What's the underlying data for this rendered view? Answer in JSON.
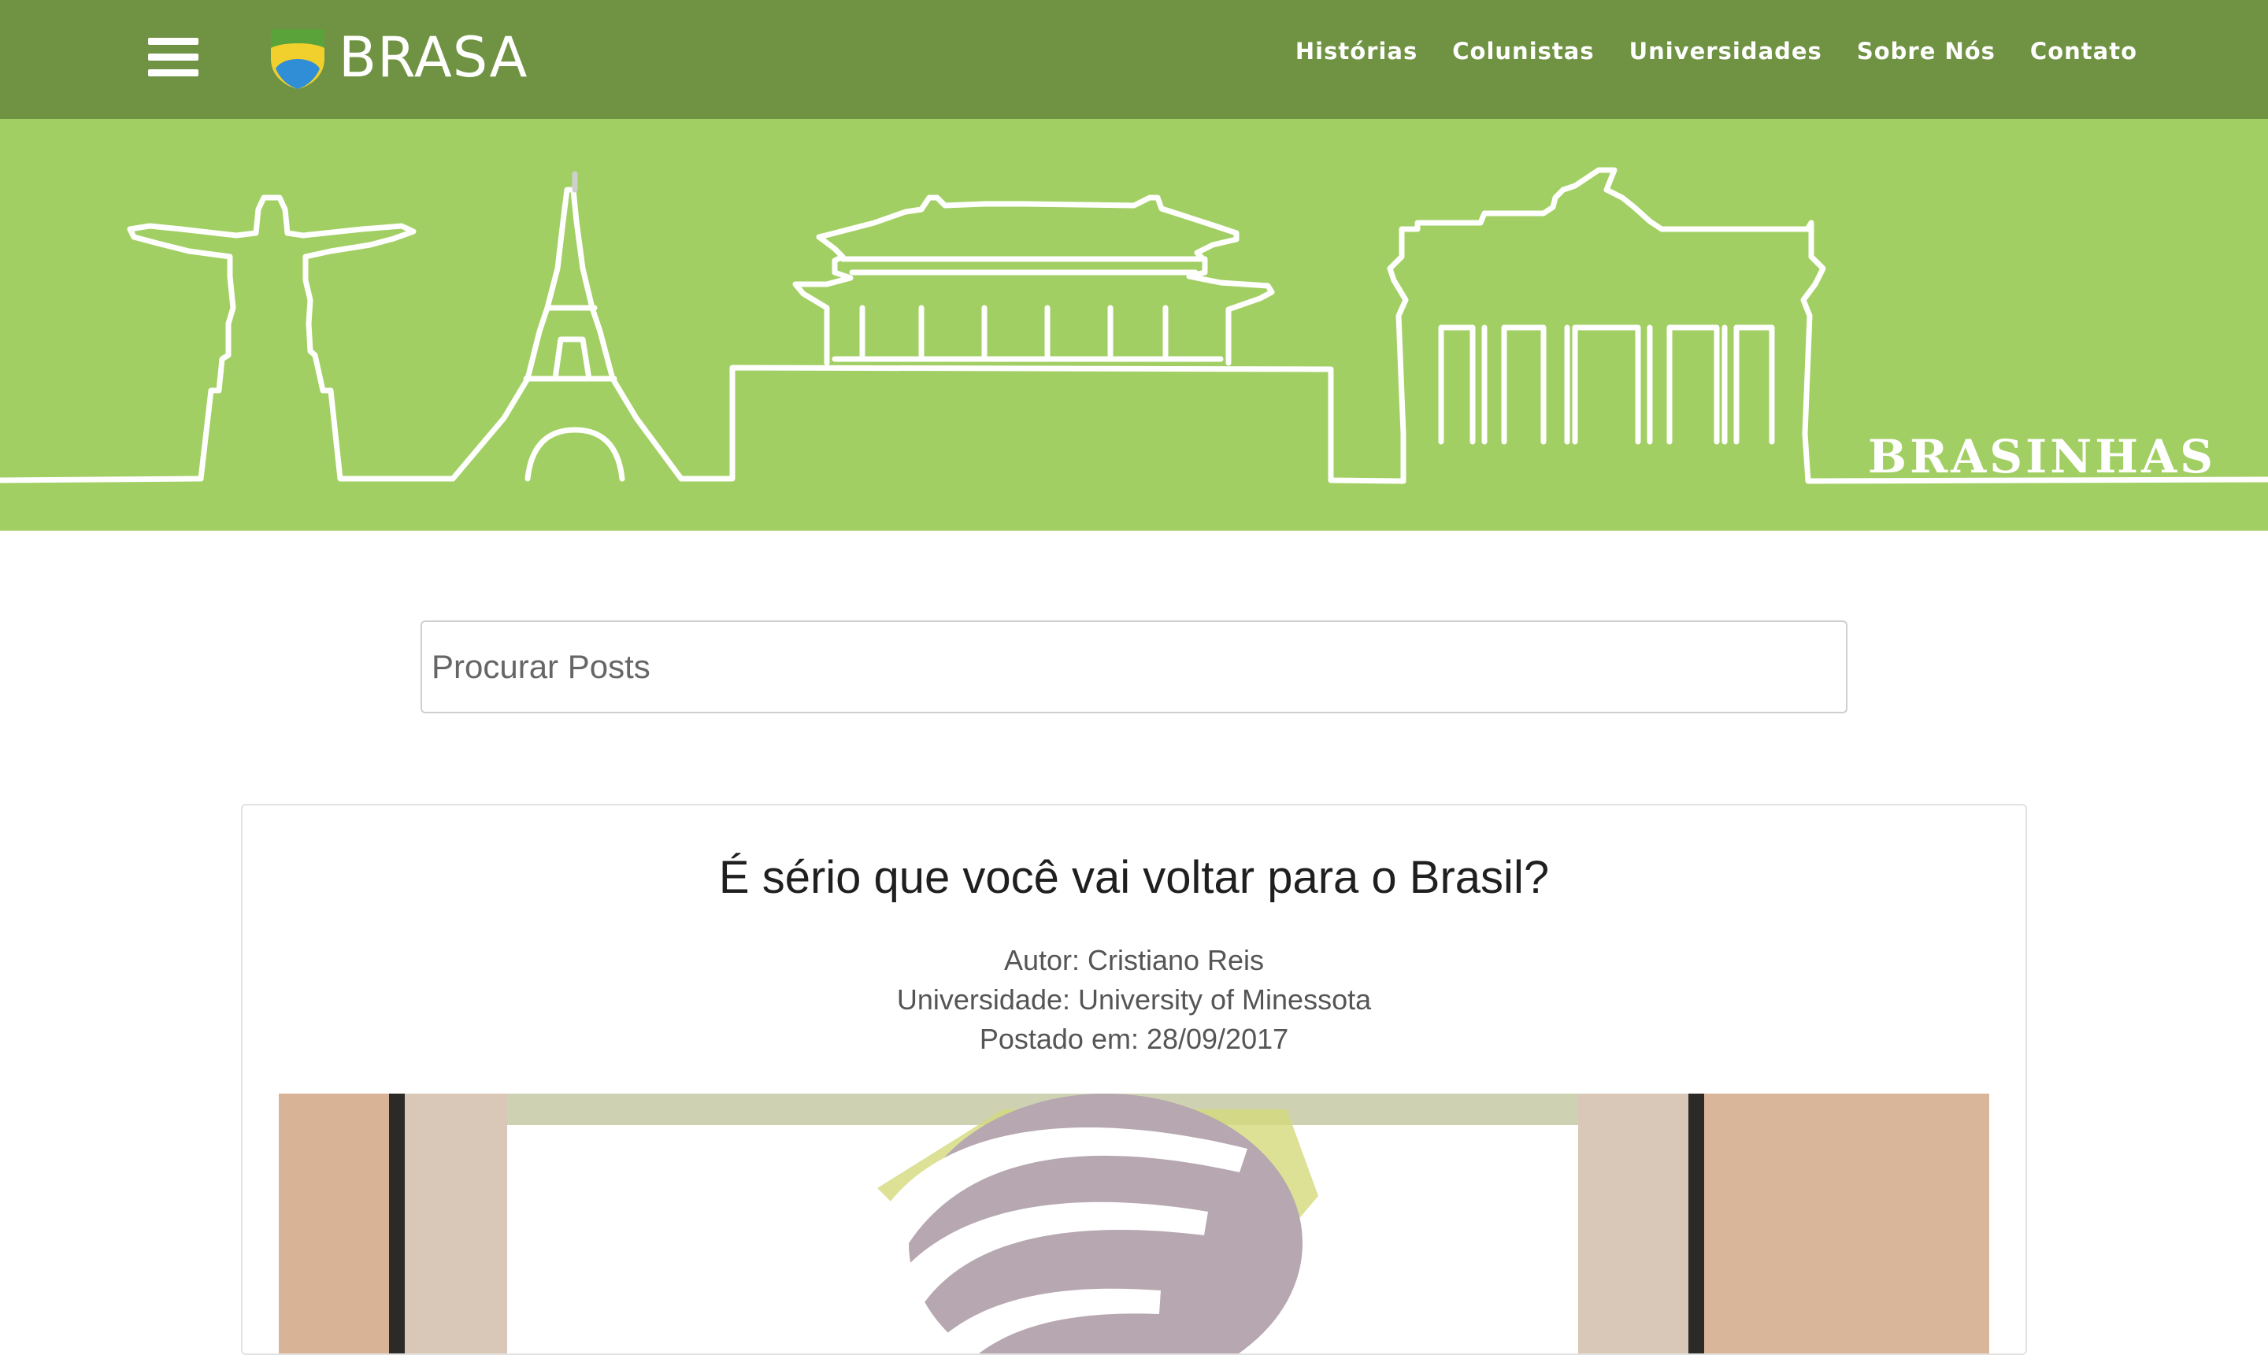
{
  "header": {
    "brand": "BRASA",
    "nav": [
      "Histórias",
      "Colunistas",
      "Universidades",
      "Sobre Nós",
      "Contato"
    ]
  },
  "hero": {
    "label": "BRASINHAS"
  },
  "search": {
    "placeholder": "Procurar Posts"
  },
  "post": {
    "title": "É sério que você vai voltar para o Brasil?",
    "author": "Autor: Cristiano Reis",
    "university": "Universidade: University of Minessota",
    "date": "Postado em: 28/09/2017"
  },
  "colors": {
    "navbar": "#6f9243",
    "hero": "#a2cf63",
    "logo_yellow": "#f1cf2c",
    "logo_blue": "#2f8ed6",
    "logo_green": "#5aa23a"
  }
}
